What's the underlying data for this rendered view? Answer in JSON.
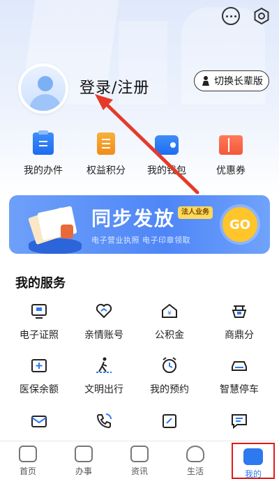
{
  "header": {
    "login_label": "登录/注册",
    "elder_mode_label": "切换长辈版"
  },
  "quick": [
    {
      "label": "我的办件",
      "icon": "document-list-icon"
    },
    {
      "label": "权益积分",
      "icon": "points-book-icon"
    },
    {
      "label": "我的钱包",
      "icon": "wallet-icon"
    },
    {
      "label": "优惠券",
      "icon": "coupon-icon"
    }
  ],
  "banner": {
    "title": "同步发放",
    "tag": "法人业务",
    "subtitle": "电子营业执照 电子印章领取",
    "go_label": "GO"
  },
  "services": {
    "title": "我的服务",
    "items": [
      {
        "label": "电子证照",
        "icon": "id-card-icon"
      },
      {
        "label": "亲情账号",
        "icon": "heart-link-icon"
      },
      {
        "label": "公积金",
        "icon": "housing-fund-icon"
      },
      {
        "label": "商鼎分",
        "icon": "ding-score-icon"
      },
      {
        "label": "医保余额",
        "icon": "medical-insurance-icon"
      },
      {
        "label": "文明出行",
        "icon": "walking-person-icon"
      },
      {
        "label": "我的预约",
        "icon": "alarm-clock-icon"
      },
      {
        "label": "智慧停车",
        "icon": "car-icon"
      },
      {
        "label": "",
        "icon": "mail-icon"
      },
      {
        "label": "",
        "icon": "phone-icon"
      },
      {
        "label": "",
        "icon": "edit-document-icon"
      },
      {
        "label": "",
        "icon": "message-icon"
      }
    ]
  },
  "tabs": [
    {
      "label": "首页",
      "icon": "home-icon"
    },
    {
      "label": "办事",
      "icon": "clock-icon"
    },
    {
      "label": "资讯",
      "icon": "news-icon"
    },
    {
      "label": "生活",
      "icon": "heart-icon"
    },
    {
      "label": "我的",
      "icon": "user-icon",
      "active": true
    }
  ],
  "colors": {
    "accent": "#2c79f0",
    "highlight_border": "#e11a1a",
    "annotation_arrow": "#e53a2a"
  }
}
